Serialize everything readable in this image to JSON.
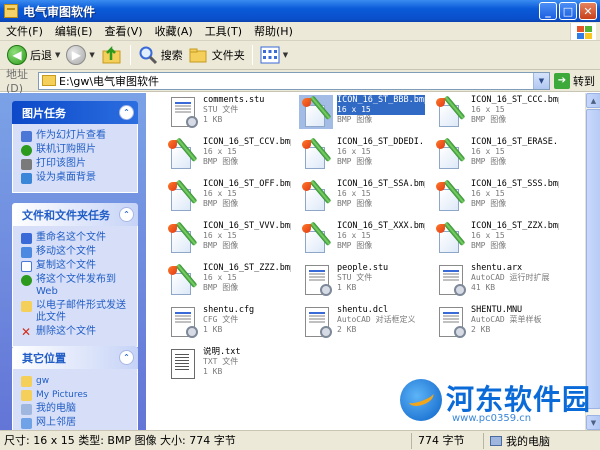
{
  "window": {
    "title": "电气审图软件",
    "buttons": {
      "minimize": "_",
      "maximize": "□",
      "close": "✕"
    }
  },
  "menu": [
    "文件(F)",
    "编辑(E)",
    "查看(V)",
    "收藏(A)",
    "工具(T)",
    "帮助(H)"
  ],
  "toolbar": {
    "back_label": "后退",
    "search_label": "搜索",
    "folders_label": "文件夹"
  },
  "address": {
    "label": "地址(D)",
    "value": "E:\\gw\\电气审图软件",
    "go_label": "转到"
  },
  "task_panels": {
    "picture_tasks": {
      "title": "图片任务",
      "items": [
        "作为幻灯片查看",
        "联机订购照片",
        "打印该图片",
        "设为桌面背景"
      ]
    },
    "file_tasks": {
      "title": "文件和文件夹任务",
      "items": [
        "重命名这个文件",
        "移动这个文件",
        "复制这个文件",
        "将这个文件发布到 Web",
        "以电子邮件形式发送此文件",
        "删除这个文件"
      ]
    },
    "other_places": {
      "title": "其它位置",
      "items": [
        "gw",
        "My Pictures",
        "我的电脑",
        "网上邻居"
      ]
    }
  },
  "files": [
    {
      "name": "comments.stu",
      "type": "STU 文件",
      "size": "1 KB",
      "icon": "doc-gear-icon",
      "selected": false
    },
    {
      "name": "ICON_16_ST_BBB.bmp",
      "type": "16 x 15",
      "size": "BMP 图像",
      "icon": "bmp-brush-icon",
      "selected": true
    },
    {
      "name": "ICON_16_ST_CCC.bmp",
      "type": "16 x 15",
      "size": "BMP 图像",
      "icon": "bmp-brush-icon",
      "selected": false
    },
    {
      "name": "ICON_16_ST_CCV.bmp",
      "type": "16 x 15",
      "size": "BMP 图像",
      "icon": "bmp-brush-icon",
      "selected": false
    },
    {
      "name": "ICON_16_ST_DDEDI...",
      "type": "16 x 15",
      "size": "BMP 图像",
      "icon": "bmp-brush-icon",
      "selected": false
    },
    {
      "name": "ICON_16_ST_ERASE...",
      "type": "16 x 15",
      "size": "BMP 图像",
      "icon": "bmp-brush-icon",
      "selected": false
    },
    {
      "name": "ICON_16_ST_OFF.bmp",
      "type": "16 x 15",
      "size": "BMP 图像",
      "icon": "bmp-brush-icon",
      "selected": false
    },
    {
      "name": "ICON_16_ST_SSA.bmp",
      "type": "16 x 15",
      "size": "BMP 图像",
      "icon": "bmp-brush-icon",
      "selected": false
    },
    {
      "name": "ICON_16_ST_SSS.bmp",
      "type": "16 x 15",
      "size": "BMP 图像",
      "icon": "bmp-brush-icon",
      "selected": false
    },
    {
      "name": "ICON_16_ST_VVV.bmp",
      "type": "16 x 15",
      "size": "BMP 图像",
      "icon": "bmp-brush-icon",
      "selected": false
    },
    {
      "name": "ICON_16_ST_XXX.bmp",
      "type": "16 x 15",
      "size": "BMP 图像",
      "icon": "bmp-brush-icon",
      "selected": false
    },
    {
      "name": "ICON_16_ST_ZZX.bmp",
      "type": "16 x 15",
      "size": "BMP 图像",
      "icon": "bmp-brush-icon",
      "selected": false
    },
    {
      "name": "ICON_16_ST_ZZZ.bmp",
      "type": "16 x 15",
      "size": "BMP 图像",
      "icon": "bmp-brush-icon",
      "selected": false
    },
    {
      "name": "people.stu",
      "type": "STU 文件",
      "size": "1 KB",
      "icon": "doc-gear-icon",
      "selected": false
    },
    {
      "name": "shentu.arx",
      "type": "AutoCAD 运行时扩展",
      "size": "41 KB",
      "icon": "doc-gear-icon",
      "selected": false
    },
    {
      "name": "shentu.cfg",
      "type": "CFG 文件",
      "size": "1 KB",
      "icon": "doc-gear-icon",
      "selected": false
    },
    {
      "name": "shentu.dcl",
      "type": "AutoCAD 对话框定义",
      "size": "2 KB",
      "icon": "doc-gear-icon",
      "selected": false
    },
    {
      "name": "SHENTU.MNU",
      "type": "AutoCAD 菜单样板",
      "size": "2 KB",
      "icon": "doc-gear-icon",
      "selected": false
    },
    {
      "name": "说明.txt",
      "type": "TXT 文件",
      "size": "1 KB",
      "icon": "text-doc-icon",
      "selected": false
    }
  ],
  "status": {
    "left": "尺寸: 16 x 15 类型: BMP 图像 大小: 774 字节",
    "middle": "774 字节",
    "right": "我的电脑"
  },
  "watermark": {
    "title": "河东软件园",
    "url": "www.pc0359.cn"
  },
  "colors": {
    "title_bar": "#0a4fcb",
    "task_pane": "#6f8fe0",
    "selection": "#316ac5",
    "link": "#215dc6"
  }
}
